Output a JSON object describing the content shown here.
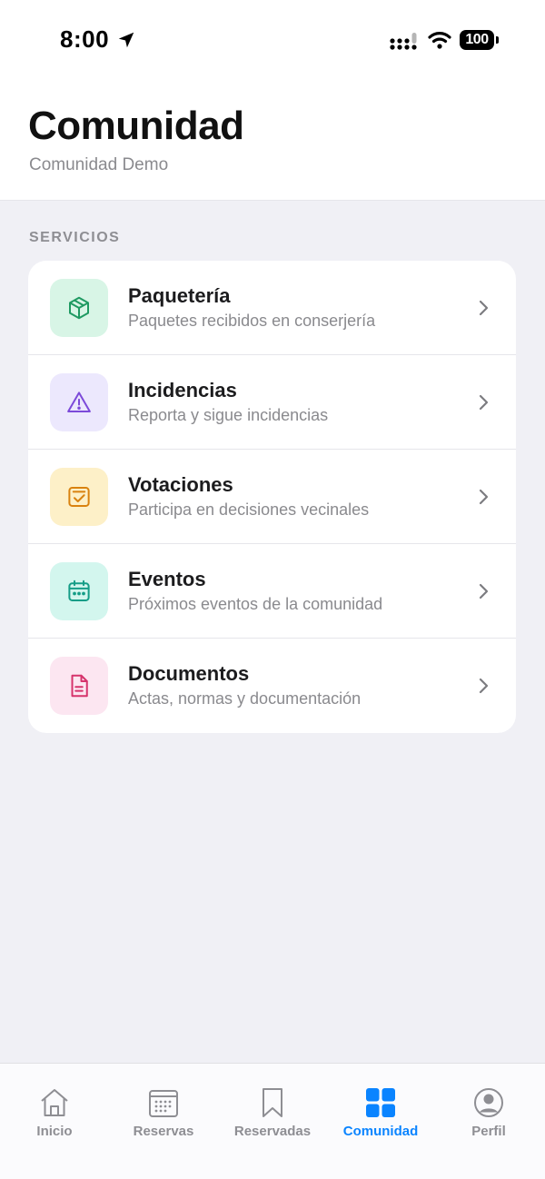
{
  "status_bar": {
    "time": "8:00",
    "battery": "100"
  },
  "header": {
    "title": "Comunidad",
    "subtitle": "Comunidad Demo"
  },
  "section": {
    "label": "SERVICIOS"
  },
  "services": [
    {
      "title": "Paquetería",
      "subtitle": "Paquetes recibidos en conserjería",
      "icon": "package-icon",
      "bg": "#d8f5e6",
      "color": "#1f9a62"
    },
    {
      "title": "Incidencias",
      "subtitle": "Reporta y sigue incidencias",
      "icon": "warning-icon",
      "bg": "#ece8fd",
      "color": "#7c4ad9"
    },
    {
      "title": "Votaciones",
      "subtitle": "Participa en decisiones vecinales",
      "icon": "vote-checkbox-icon",
      "bg": "#fdf0c8",
      "color": "#d9820f"
    },
    {
      "title": "Eventos",
      "subtitle": "Próximos eventos de la comunidad",
      "icon": "calendar-icon",
      "bg": "#d3f6ee",
      "color": "#159d87"
    },
    {
      "title": "Documentos",
      "subtitle": "Actas, normas y documentación",
      "icon": "document-icon",
      "bg": "#fce6f1",
      "color": "#d6336c"
    }
  ],
  "tabs": [
    {
      "label": "Inicio",
      "icon": "home-icon",
      "active": false
    },
    {
      "label": "Reservas",
      "icon": "calendar-grid-icon",
      "active": false
    },
    {
      "label": "Reservadas",
      "icon": "bookmark-icon",
      "active": false
    },
    {
      "label": "Comunidad",
      "icon": "grid-icon",
      "active": true
    },
    {
      "label": "Perfil",
      "icon": "profile-icon",
      "active": false
    }
  ],
  "colors": {
    "accent": "#0a84ff",
    "inactive": "#8e8e93",
    "background": "#f0f0f5"
  }
}
